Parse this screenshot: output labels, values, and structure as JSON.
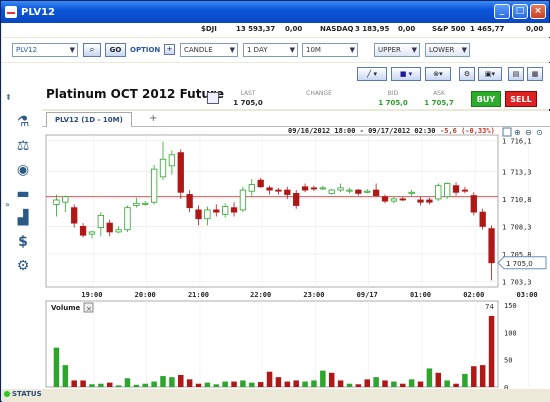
{
  "window": {
    "title": "PLV12"
  },
  "indices": [
    {
      "name": "$DJI",
      "value": "13 593,37",
      "change": "0,00"
    },
    {
      "name": "NASDAQ",
      "value": "3 183,95",
      "change": "0,00"
    },
    {
      "name": "S&P 500",
      "value": "1 465,77",
      "change": "0,00"
    }
  ],
  "toolbar": {
    "symbol": "PLV12",
    "go_label": "GO",
    "option_label": "OPTION",
    "chart_type": "CANDLE",
    "period": "1 DAY",
    "interval": "10M",
    "upper": "UPPER",
    "lower": "LOWER"
  },
  "instrument": {
    "title": "Platinum OCT 2012 Future",
    "last_label": "LAST",
    "last_value": "1 705,0",
    "change_label": "CHANGE",
    "change_value": "",
    "bid_label": "BID",
    "bid_value": "1 705,0",
    "ask_label": "ASK",
    "ask_value": "1 705,7",
    "buy_label": "BUY",
    "sell_label": "SELL"
  },
  "tab": {
    "label": "PLV12 (1D - 10M)",
    "add": "+"
  },
  "chart_info": {
    "range": "09/16/2012 18:00 - 09/17/2012 02:30",
    "change": "-5,6 (-0,33%)"
  },
  "volume_panel": {
    "label": "Volume",
    "close": "×",
    "marker": "74"
  },
  "status": {
    "label": "STATUS"
  },
  "colors": {
    "up": "#2ea62e",
    "down": "#b01818",
    "priceline": "#d04040",
    "accent": "#2a5aa0"
  },
  "chart_data": {
    "type": "candlestick",
    "x_ticks": [
      "19:00",
      "20:00",
      "21:00",
      "22:00",
      "23:00",
      "09/17",
      "01:00",
      "02:00",
      "03:00"
    ],
    "y_ticks": [
      "1 716,1",
      "1 713,3",
      "1 710,8",
      "1 708,3",
      "1 705,8",
      "1 703,3"
    ],
    "y_range": [
      1702.8,
      1716.6
    ],
    "last_price": "1 705,0",
    "volume_ticks": [
      "150",
      "100",
      "50",
      "0"
    ],
    "volume_range": [
      0,
      150
    ],
    "candles": [
      {
        "o": 1710.3,
        "h": 1711.2,
        "l": 1709.2,
        "c": 1710.7
      },
      {
        "o": 1710.5,
        "h": 1711.1,
        "l": 1709.6,
        "c": 1711.0
      },
      {
        "o": 1710.0,
        "h": 1710.3,
        "l": 1708.2,
        "c": 1708.6
      },
      {
        "o": 1708.3,
        "h": 1708.6,
        "l": 1707.3,
        "c": 1707.5
      },
      {
        "o": 1707.6,
        "h": 1707.9,
        "l": 1707.2,
        "c": 1707.8
      },
      {
        "o": 1708.2,
        "h": 1709.6,
        "l": 1707.4,
        "c": 1709.3
      },
      {
        "o": 1708.6,
        "h": 1708.9,
        "l": 1707.4,
        "c": 1707.8
      },
      {
        "o": 1707.8,
        "h": 1708.3,
        "l": 1707.7,
        "c": 1708.0
      },
      {
        "o": 1708.0,
        "h": 1710.2,
        "l": 1707.8,
        "c": 1710.0
      },
      {
        "o": 1710.2,
        "h": 1710.9,
        "l": 1710.0,
        "c": 1710.4
      },
      {
        "o": 1710.3,
        "h": 1710.6,
        "l": 1710.2,
        "c": 1710.4
      },
      {
        "o": 1710.5,
        "h": 1713.9,
        "l": 1710.3,
        "c": 1713.5
      },
      {
        "o": 1712.8,
        "h": 1716.0,
        "l": 1712.5,
        "c": 1714.4
      },
      {
        "o": 1713.8,
        "h": 1715.2,
        "l": 1713.0,
        "c": 1714.8
      },
      {
        "o": 1715.0,
        "h": 1715.3,
        "l": 1710.8,
        "c": 1711.4
      },
      {
        "o": 1711.2,
        "h": 1711.6,
        "l": 1709.6,
        "c": 1710.0
      },
      {
        "o": 1709.8,
        "h": 1710.2,
        "l": 1708.4,
        "c": 1709.0
      },
      {
        "o": 1709.0,
        "h": 1710.1,
        "l": 1708.4,
        "c": 1709.8
      },
      {
        "o": 1709.8,
        "h": 1710.3,
        "l": 1709.2,
        "c": 1709.6
      },
      {
        "o": 1709.4,
        "h": 1710.4,
        "l": 1709.1,
        "c": 1710.1
      },
      {
        "o": 1710.0,
        "h": 1710.5,
        "l": 1709.2,
        "c": 1709.6
      },
      {
        "o": 1709.8,
        "h": 1711.9,
        "l": 1709.6,
        "c": 1711.6
      },
      {
        "o": 1711.5,
        "h": 1712.6,
        "l": 1711.0,
        "c": 1712.1
      },
      {
        "o": 1712.5,
        "h": 1712.7,
        "l": 1711.8,
        "c": 1711.9
      },
      {
        "o": 1711.8,
        "h": 1712.0,
        "l": 1711.2,
        "c": 1711.6
      },
      {
        "o": 1711.6,
        "h": 1711.8,
        "l": 1711.2,
        "c": 1711.5
      },
      {
        "o": 1711.6,
        "h": 1711.9,
        "l": 1710.8,
        "c": 1711.2
      },
      {
        "o": 1711.3,
        "h": 1711.6,
        "l": 1709.9,
        "c": 1710.2
      },
      {
        "o": 1711.9,
        "h": 1712.2,
        "l": 1711.4,
        "c": 1711.6
      },
      {
        "o": 1711.8,
        "h": 1712.0,
        "l": 1711.5,
        "c": 1711.7
      },
      {
        "o": 1711.7,
        "h": 1712.0,
        "l": 1711.6,
        "c": 1711.8
      },
      {
        "o": 1711.3,
        "h": 1711.7,
        "l": 1711.2,
        "c": 1711.6
      },
      {
        "o": 1711.6,
        "h": 1712.2,
        "l": 1711.4,
        "c": 1711.8
      },
      {
        "o": 1711.5,
        "h": 1711.8,
        "l": 1711.3,
        "c": 1711.6
      },
      {
        "o": 1711.6,
        "h": 1711.7,
        "l": 1711.1,
        "c": 1711.3
      },
      {
        "o": 1711.4,
        "h": 1711.7,
        "l": 1711.3,
        "c": 1711.5
      },
      {
        "o": 1711.6,
        "h": 1712.2,
        "l": 1711.0,
        "c": 1711.1
      },
      {
        "o": 1711.0,
        "h": 1711.2,
        "l": 1710.4,
        "c": 1710.6
      },
      {
        "o": 1710.6,
        "h": 1711.0,
        "l": 1710.4,
        "c": 1710.8
      },
      {
        "o": 1710.8,
        "h": 1711.0,
        "l": 1710.6,
        "c": 1710.7
      },
      {
        "o": 1711.3,
        "h": 1711.6,
        "l": 1711.0,
        "c": 1711.4
      },
      {
        "o": 1710.7,
        "h": 1711.0,
        "l": 1710.2,
        "c": 1710.5
      },
      {
        "o": 1710.7,
        "h": 1710.9,
        "l": 1710.3,
        "c": 1710.5
      },
      {
        "o": 1710.8,
        "h": 1712.2,
        "l": 1710.6,
        "c": 1712.0
      },
      {
        "o": 1711.0,
        "h": 1712.3,
        "l": 1710.8,
        "c": 1712.2
      },
      {
        "o": 1712.0,
        "h": 1712.3,
        "l": 1711.1,
        "c": 1711.4
      },
      {
        "o": 1711.6,
        "h": 1711.9,
        "l": 1711.3,
        "c": 1711.5
      },
      {
        "o": 1711.1,
        "h": 1711.4,
        "l": 1709.3,
        "c": 1709.6
      },
      {
        "o": 1709.6,
        "h": 1709.9,
        "l": 1708.0,
        "c": 1708.3
      },
      {
        "o": 1708.1,
        "h": 1708.4,
        "l": 1703.4,
        "c": 1705.0
      }
    ],
    "volumes": [
      {
        "v": 72,
        "up": true
      },
      {
        "v": 40,
        "up": true
      },
      {
        "v": 12,
        "up": false
      },
      {
        "v": 12,
        "up": false
      },
      {
        "v": 5,
        "up": true
      },
      {
        "v": 6,
        "up": true
      },
      {
        "v": 8,
        "up": false
      },
      {
        "v": 3,
        "up": true
      },
      {
        "v": 16,
        "up": true
      },
      {
        "v": 4,
        "up": true
      },
      {
        "v": 6,
        "up": true
      },
      {
        "v": 10,
        "up": true
      },
      {
        "v": 20,
        "up": true
      },
      {
        "v": 18,
        "up": true
      },
      {
        "v": 22,
        "up": false
      },
      {
        "v": 14,
        "up": false
      },
      {
        "v": 6,
        "up": false
      },
      {
        "v": 8,
        "up": true
      },
      {
        "v": 5,
        "up": true
      },
      {
        "v": 10,
        "up": true
      },
      {
        "v": 10,
        "up": false
      },
      {
        "v": 12,
        "up": true
      },
      {
        "v": 8,
        "up": true
      },
      {
        "v": 9,
        "up": false
      },
      {
        "v": 28,
        "up": false
      },
      {
        "v": 18,
        "up": false
      },
      {
        "v": 10,
        "up": false
      },
      {
        "v": 12,
        "up": false
      },
      {
        "v": 10,
        "up": true
      },
      {
        "v": 12,
        "up": true
      },
      {
        "v": 30,
        "up": true
      },
      {
        "v": 26,
        "up": false
      },
      {
        "v": 12,
        "up": false
      },
      {
        "v": 6,
        "up": true
      },
      {
        "v": 5,
        "up": false
      },
      {
        "v": 14,
        "up": false
      },
      {
        "v": 18,
        "up": true
      },
      {
        "v": 12,
        "up": false
      },
      {
        "v": 10,
        "up": true
      },
      {
        "v": 6,
        "up": false
      },
      {
        "v": 14,
        "up": true
      },
      {
        "v": 10,
        "up": false
      },
      {
        "v": 34,
        "up": true
      },
      {
        "v": 26,
        "up": false
      },
      {
        "v": 12,
        "up": true
      },
      {
        "v": 6,
        "up": false
      },
      {
        "v": 24,
        "up": true
      },
      {
        "v": 38,
        "up": false
      },
      {
        "v": 40,
        "up": false
      },
      {
        "v": 130,
        "up": false
      }
    ]
  }
}
